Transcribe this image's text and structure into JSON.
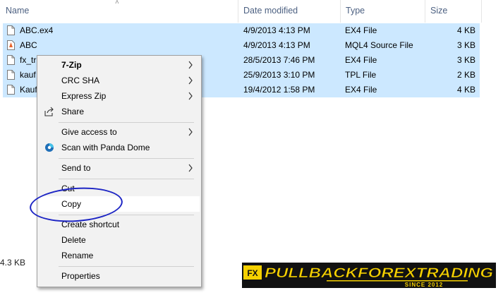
{
  "columns": {
    "name": "Name",
    "date": "Date modified",
    "type": "Type",
    "size": "Size"
  },
  "files": [
    {
      "name": "ABC.ex4",
      "date": "4/9/2013 4:13 PM",
      "type": "EX4 File",
      "size": "4 KB",
      "icon": "file-icon"
    },
    {
      "name": "ABC",
      "date": "4/9/2013 4:13 PM",
      "type": "MQL4 Source File",
      "size": "3 KB",
      "icon": "mql4-file-icon"
    },
    {
      "name": "fx_tr",
      "date": "28/5/2013 7:46 PM",
      "type": "EX4 File",
      "size": "3 KB",
      "icon": "file-icon"
    },
    {
      "name": "kauf",
      "date": "25/9/2013 3:10 PM",
      "type": "TPL File",
      "size": "2 KB",
      "icon": "file-icon"
    },
    {
      "name": "Kauf",
      "date": "19/4/2012 1:58 PM",
      "type": "EX4 File",
      "size": "4 KB",
      "icon": "file-icon"
    }
  ],
  "status": {
    "size_text": "4.3 KB"
  },
  "menu": {
    "seven_zip": "7-Zip",
    "crc_sha": "CRC SHA",
    "express_zip": "Express Zip",
    "share": "Share",
    "give_access": "Give access to",
    "scan_panda": "Scan with Panda Dome",
    "send_to": "Send to",
    "cut": "Cut",
    "copy": "Copy",
    "create_shortcut": "Create shortcut",
    "delete": "Delete",
    "rename": "Rename",
    "properties": "Properties"
  },
  "logo": {
    "badge": "FX",
    "text": "PULLBACKFOREXTRADING",
    "tagline": "SINCE 2012"
  },
  "colors": {
    "selection": "#cce8ff",
    "annotation": "#1c24c4",
    "logo_yellow": "#f5d000"
  }
}
